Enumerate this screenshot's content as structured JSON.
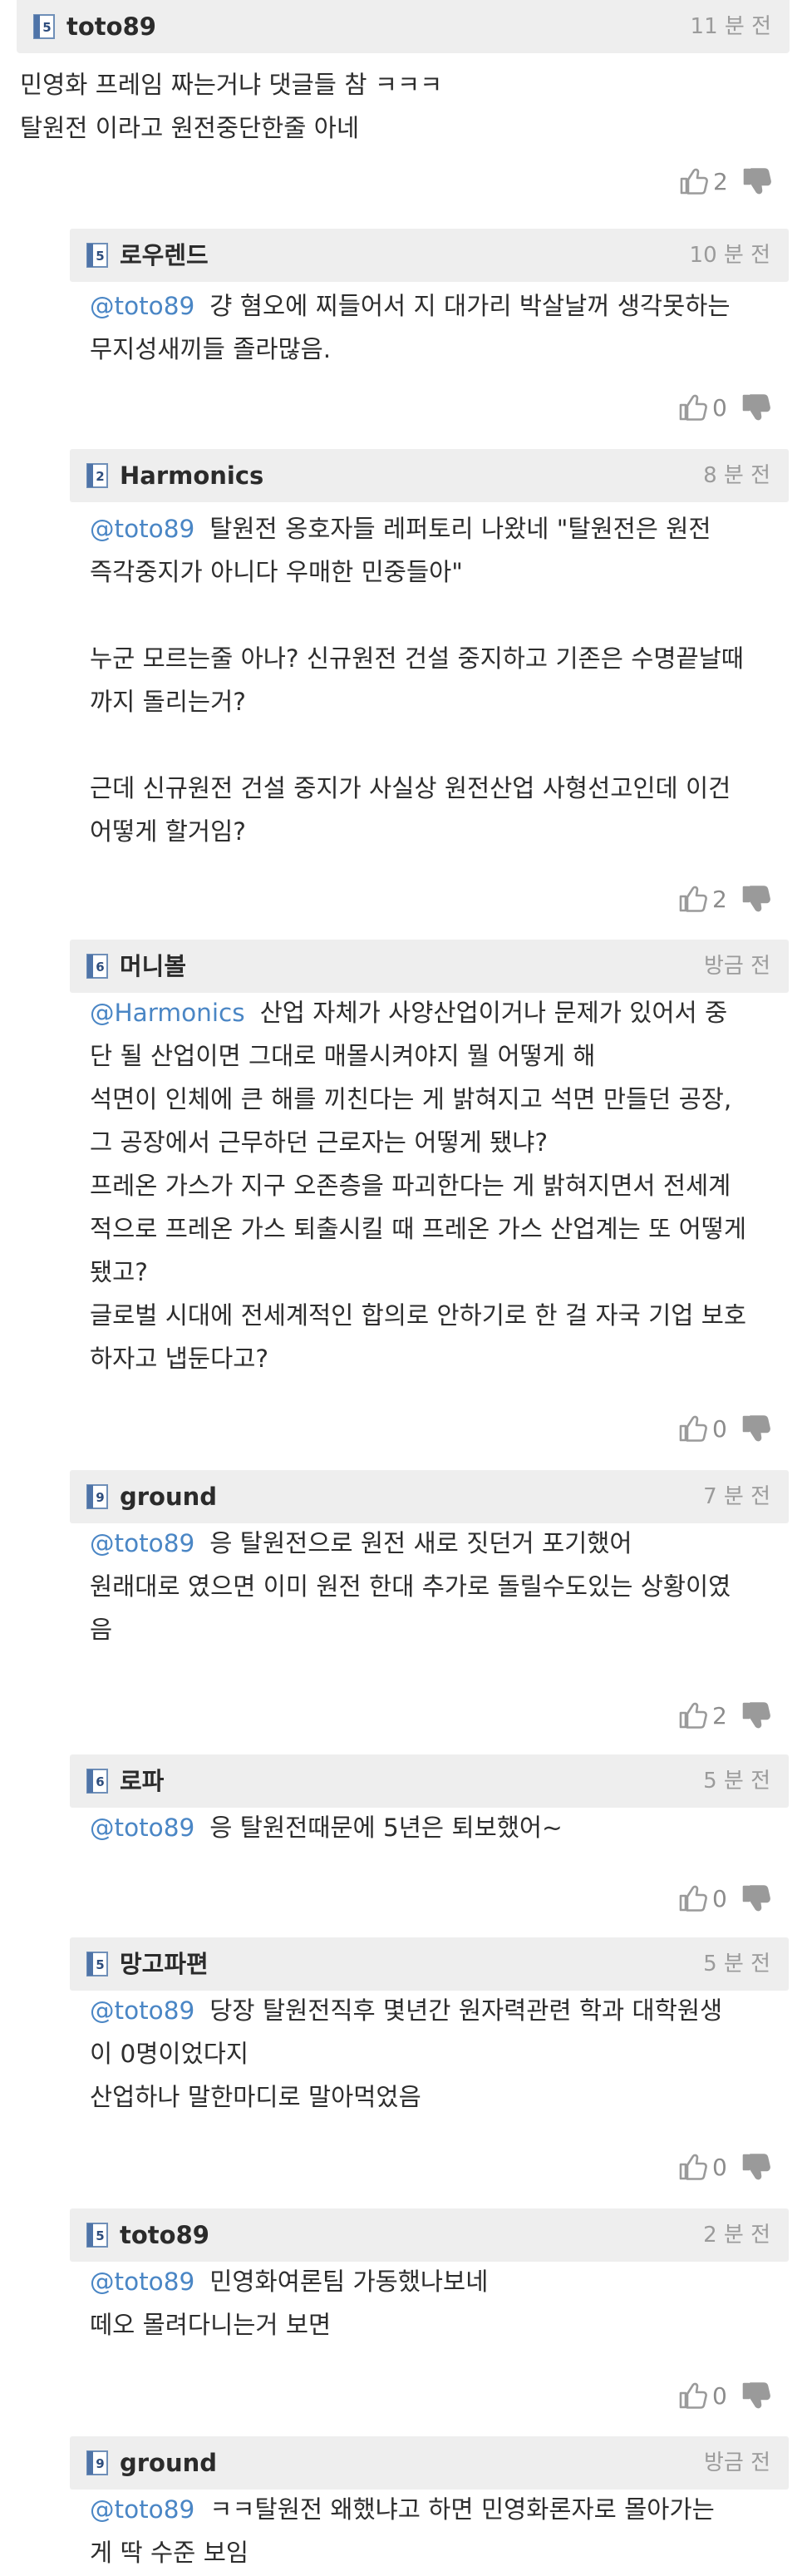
{
  "comments": [
    {
      "author": "toto89",
      "level": "5",
      "time": "11 분 전",
      "mention": "",
      "lines": [
        "민영화 프레임 짜는거냐 댓글들 참 ㅋㅋㅋ",
        "탈원전 이라고 원전중단한줄 아네"
      ],
      "likes": "2"
    },
    {
      "author": "로우렌드",
      "level": "5",
      "time": "10 분 전",
      "mention": "@toto89",
      "lines": [
        "걍 혐오에 찌들어서 지 대가리 박살날꺼 생각못하는",
        "무지성새끼들 졸라많음."
      ],
      "likes": "0"
    },
    {
      "author": "Harmonics",
      "level": "2",
      "time": "8 분 전",
      "mention": "@toto89",
      "lines": [
        "탈원전 옹호자들 레퍼토리 나왔네 \"탈원전은 원전",
        "즉각중지가 아니다 우매한 민중들아\"",
        "",
        "누군 모르는줄 아나? 신규원전 건설 중지하고 기존은 수명끝날때",
        "까지 돌리는거?",
        "",
        "근데 신규원전 건설 중지가 사실상 원전산업 사형선고인데 이건",
        "어떻게 할거임?"
      ],
      "likes": "2"
    },
    {
      "author": "머니볼",
      "level": "6",
      "time": "방금 전",
      "mention": "@Harmonics",
      "lines": [
        "산업 자체가 사양산업이거나 문제가 있어서 중",
        "단 될 산업이면 그대로 매몰시켜야지 뭘 어떻게 해",
        "석면이 인체에 큰 해를 끼친다는 게 밝혀지고 석면 만들던 공장,",
        "그 공장에서 근무하던 근로자는 어떻게 됐냐?",
        "프레온 가스가 지구 오존층을 파괴한다는 게 밝혀지면서 전세계",
        "적으로 프레온 가스 퇴출시킬 때 프레온 가스 산업계는 또 어떻게",
        "됐고?",
        "글로벌 시대에 전세계적인 합의로 안하기로 한 걸 자국 기업 보호",
        "하자고 냅둔다고?"
      ],
      "likes": "0"
    },
    {
      "author": "ground",
      "level": "9",
      "time": "7 분 전",
      "mention": "@toto89",
      "lines": [
        "응 탈원전으로 원전 새로 짓던거 포기했어",
        "원래대로 였으면 이미 원전 한대 추가로 돌릴수도있는 상황이였",
        "음"
      ],
      "likes": "2"
    },
    {
      "author": "로파",
      "level": "6",
      "time": "5 분 전",
      "mention": "@toto89",
      "lines": [
        "응 탈원전때문에 5년은 퇴보했어~"
      ],
      "likes": "0"
    },
    {
      "author": "망고파편",
      "level": "5",
      "time": "5 분 전",
      "mention": "@toto89",
      "lines": [
        "당장 탈원전직후 몇년간 원자력관련 학과 대학원생",
        "이 0명이었다지",
        "산업하나 말한마디로 말아먹었음"
      ],
      "likes": "0"
    },
    {
      "author": "toto89",
      "level": "5",
      "time": "2 분 전",
      "mention": "@toto89",
      "lines": [
        "민영화여론팀 가동했나보네",
        "떼오 몰려다니는거 보면"
      ],
      "likes": "0"
    },
    {
      "author": "ground",
      "level": "9",
      "time": "방금 전",
      "mention": "@toto89",
      "lines": [
        "ㅋㅋ탈원전 왜했냐고 하면 민영화론자로 몰아가는",
        "게 딱 수준 보임"
      ],
      "likes": ""
    }
  ]
}
